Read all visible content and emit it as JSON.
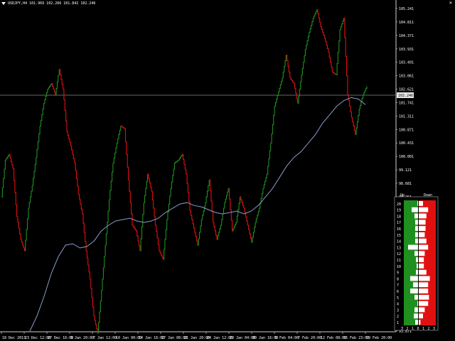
{
  "window": {
    "title": "USDJPY,H4  101.969 102.266 101.842 102.246",
    "close_glyph": "×"
  },
  "price_axis": {
    "labels": [
      "105.241",
      "104.811",
      "104.371",
      "103.931",
      "103.491",
      "103.061",
      "102.621",
      "101.741",
      "101.311",
      "100.871",
      "100.431",
      "100.001",
      "99.121",
      "98.681",
      "98.251",
      "97.811",
      "97.371",
      "96.931",
      "96.491",
      "96.061",
      "95.621",
      "95.181",
      "94.751",
      "94.311",
      "93.871"
    ],
    "current_price": "102.246",
    "colors": {
      "grid_current": "#8a8a8a",
      "axis_line": "#cfcfcf"
    }
  },
  "time_axis": {
    "labels": [
      "18 Dec 2013",
      "23 Dec 12:00",
      "27 Dec 16:00",
      "3 Jan 20:00",
      "7 Jan 12:00",
      "10 Jan 00:00",
      "14 Jan 16:00",
      "17 Jan 08:00",
      "21 Jan 20:00",
      "24 Jan 12:00",
      "29 Jan 04:00",
      "30 Jan 16:00",
      "5 Feb 04:00",
      "7 Feb 20:00",
      "12 Feb 08:00",
      "16 Feb 23:00",
      "19 Feb 20:00"
    ]
  },
  "chart_data": {
    "type": "line",
    "symbol": "USDJPY",
    "timeframe": "H4",
    "ohlc_header": {
      "open": 101.969,
      "high": 102.266,
      "low": 101.842,
      "close": 102.246
    },
    "ylim": [
      93.871,
      105.241
    ],
    "series": [
      {
        "name": "price",
        "colors": {
          "up": "#1f8f1f",
          "down": "#e01010"
        },
        "values": [
          98.6,
          99.9,
          100.1,
          99.6,
          97.9,
          97.1,
          96.7,
          98.2,
          99.0,
          100.0,
          101.1,
          101.9,
          102.4,
          102.6,
          102.2,
          103.1,
          102.4,
          100.9,
          100.4,
          99.8,
          98.7,
          98.0,
          96.7,
          95.7,
          94.4,
          93.8,
          95.3,
          96.9,
          98.5,
          99.8,
          100.5,
          101.1,
          101.0,
          99.2,
          97.6,
          97.4,
          96.7,
          98.4,
          99.4,
          98.8,
          97.6,
          96.7,
          96.4,
          97.8,
          98.9,
          99.8,
          99.9,
          100.1,
          99.4,
          98.1,
          97.5,
          96.9,
          97.8,
          98.4,
          99.2,
          97.7,
          97.1,
          97.6,
          98.4,
          98.9,
          97.4,
          97.7,
          98.6,
          98.2,
          97.6,
          97.0,
          97.7,
          98.2,
          98.9,
          99.4,
          100.5,
          101.8,
          102.3,
          102.8,
          103.6,
          102.8,
          102.6,
          101.9,
          102.9,
          103.8,
          104.4,
          104.9,
          105.2,
          104.6,
          104.2,
          103.7,
          103.0,
          102.9,
          104.5,
          104.9,
          102.2,
          101.4,
          100.8,
          101.7,
          102.2,
          102.5
        ]
      },
      {
        "name": "moving average",
        "color": "#8a9cc8",
        "values": [
          93.87,
          94.4,
          95.1,
          95.9,
          96.5,
          96.9,
          96.95,
          96.8,
          96.85,
          97.05,
          97.4,
          97.6,
          97.75,
          97.8,
          97.85,
          97.75,
          97.7,
          97.75,
          97.85,
          98.05,
          98.2,
          98.35,
          98.4,
          98.3,
          98.25,
          98.15,
          98.05,
          98.0,
          98.05,
          98.1,
          98.0,
          98.1,
          98.3,
          98.6,
          98.9,
          99.3,
          99.7,
          100.0,
          100.2,
          100.5,
          100.8,
          101.2,
          101.5,
          101.8,
          102.0,
          102.1,
          102.05,
          101.85
        ]
      }
    ]
  },
  "histogram_panel": {
    "label_up": "Up",
    "label_down": "Down",
    "levels": [
      "20",
      "19",
      "18",
      "17",
      "16",
      "15",
      "14",
      "13",
      "12",
      "11",
      "10",
      "9",
      "8",
      "7",
      "6",
      "5",
      "4",
      "3",
      "2",
      "1"
    ],
    "bottom_labels": [
      "3",
      "2",
      "1",
      "0",
      "1",
      "2",
      "3"
    ],
    "up_fractions": [
      0.05,
      0.45,
      0.25,
      0.2,
      0.2,
      0.2,
      0.2,
      0.7,
      0.25,
      0.15,
      0.1,
      0.15,
      0.55,
      0.35,
      0.55,
      0.25,
      0.05,
      0.25,
      0.3,
      0.2
    ],
    "down_fractions": [
      0.25,
      0.55,
      0.45,
      0.4,
      0.4,
      0.35,
      0.45,
      0.55,
      0.35,
      0.3,
      0.3,
      0.45,
      0.65,
      0.55,
      0.55,
      0.6,
      0.55,
      0.35,
      0.25,
      0.1
    ],
    "colors": {
      "up": "#1f8f1f",
      "down": "#e01010",
      "bar": "#ffffff"
    }
  }
}
